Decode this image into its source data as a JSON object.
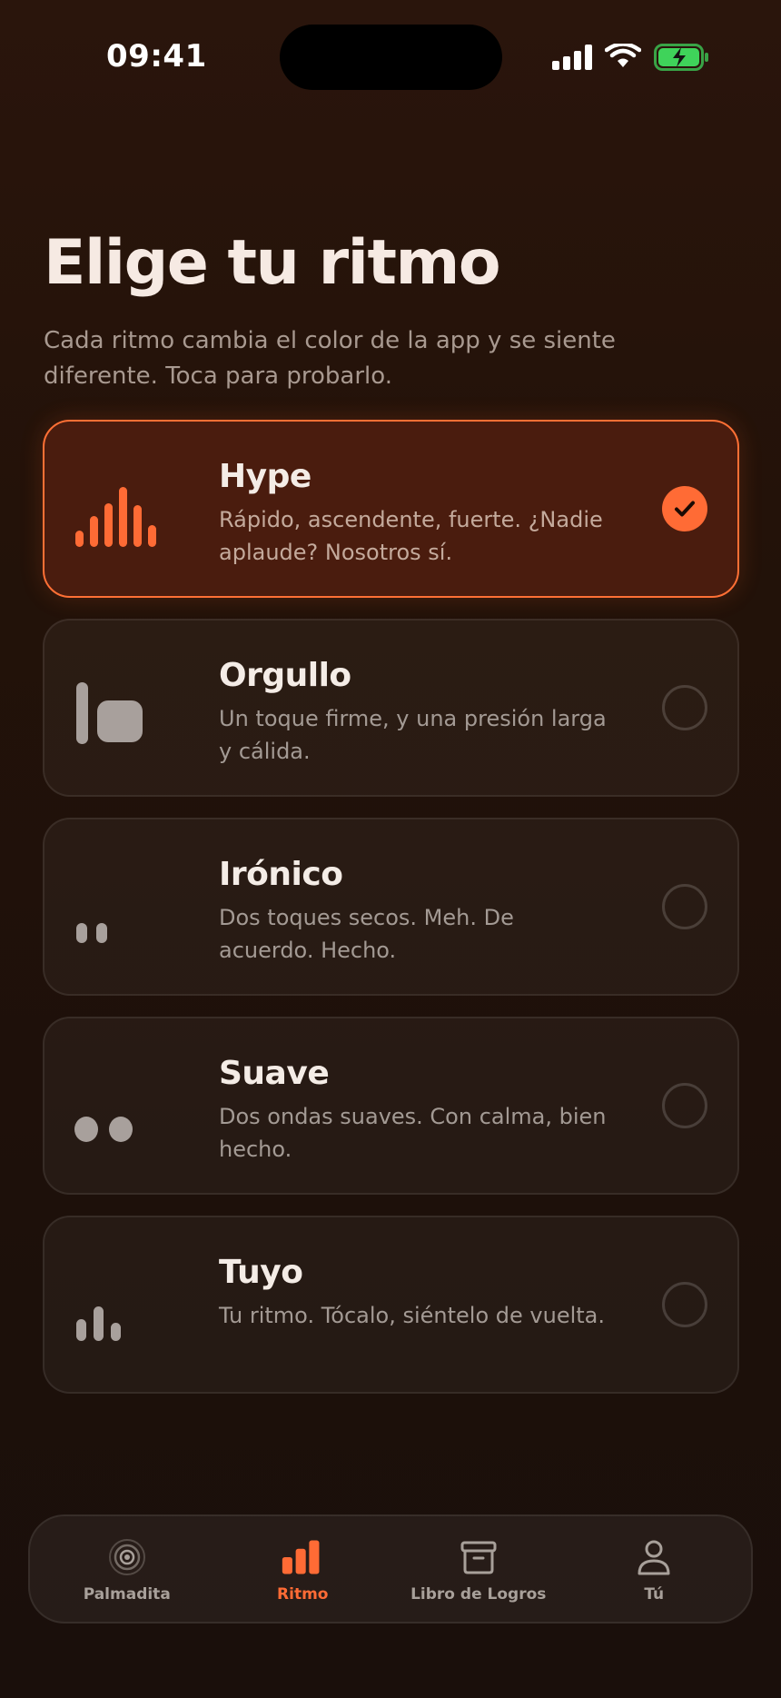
{
  "status_bar": {
    "time": "09:41"
  },
  "header": {
    "title": "Elige tu ritmo",
    "subtitle": "Cada ritmo cambia el color de la app y se siente diferente. Toca para probarlo."
  },
  "accent_color": "#ff6b35",
  "rhythms": [
    {
      "name": "Hype",
      "description": "Rápido, ascendente, fuerte. ¿Nadie aplaude? Nosotros sí.",
      "selected": true,
      "pattern_icon": "rising-bars-pattern-icon"
    },
    {
      "name": "Orgullo",
      "description": "Un toque firme, y una presión larga y cálida.",
      "selected": false,
      "pattern_icon": "tap-and-hold-pattern-icon"
    },
    {
      "name": "Irónico",
      "description": "Dos toques secos. Meh. De acuerdo. Hecho.",
      "selected": false,
      "pattern_icon": "two-short-taps-pattern-icon"
    },
    {
      "name": "Suave",
      "description": "Dos ondas suaves. Con calma, bien hecho.",
      "selected": false,
      "pattern_icon": "two-soft-waves-pattern-icon"
    },
    {
      "name": "Tuyo",
      "description": "Tu ritmo. Tócalo, siéntelo de vuelta.",
      "selected": false,
      "pattern_icon": "custom-bars-pattern-icon"
    }
  ],
  "tab_bar": {
    "tabs": [
      {
        "label": "Palmadita",
        "icon": "radar-icon",
        "active": false
      },
      {
        "label": "Ritmo",
        "icon": "bars-icon",
        "active": true
      },
      {
        "label": "Libro de Logros",
        "icon": "archive-box-icon",
        "active": false
      },
      {
        "label": "Tú",
        "icon": "person-icon",
        "active": false
      }
    ]
  }
}
